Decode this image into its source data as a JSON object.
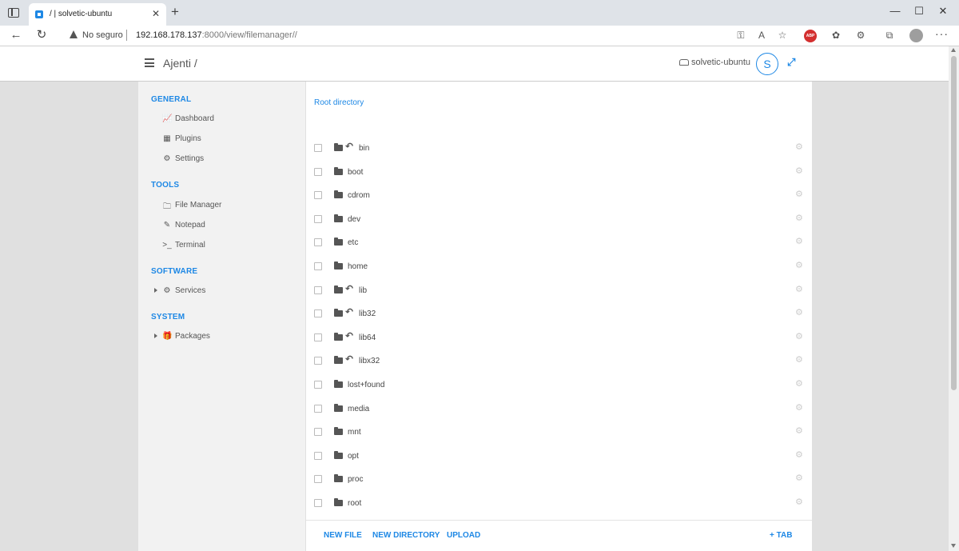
{
  "browser": {
    "tab_title": "/ | solvetic-ubuntu",
    "not_secure": "No seguro",
    "url_host": "192.168.178.137",
    "url_rest": ":8000/view/filemanager//",
    "abp": "ABP"
  },
  "header": {
    "brand": "Ajenti /",
    "hostname": "solvetic-ubuntu",
    "avatar_letter": "S"
  },
  "sidebar": {
    "general": "GENERAL",
    "dashboard": "Dashboard",
    "plugins": "Plugins",
    "settings": "Settings",
    "tools": "TOOLS",
    "file_manager": "File Manager",
    "notepad": "Notepad",
    "terminal": "Terminal",
    "software": "SOFTWARE",
    "services": "Services",
    "system": "SYSTEM",
    "packages": "Packages"
  },
  "main": {
    "breadcrumb": "Root directory",
    "files": [
      {
        "name": "bin",
        "symlink": true
      },
      {
        "name": "boot",
        "symlink": false
      },
      {
        "name": "cdrom",
        "symlink": false
      },
      {
        "name": "dev",
        "symlink": false
      },
      {
        "name": "etc",
        "symlink": false
      },
      {
        "name": "home",
        "symlink": false
      },
      {
        "name": "lib",
        "symlink": true
      },
      {
        "name": "lib32",
        "symlink": true
      },
      {
        "name": "lib64",
        "symlink": true
      },
      {
        "name": "libx32",
        "symlink": true
      },
      {
        "name": "lost+found",
        "symlink": false
      },
      {
        "name": "media",
        "symlink": false
      },
      {
        "name": "mnt",
        "symlink": false
      },
      {
        "name": "opt",
        "symlink": false
      },
      {
        "name": "proc",
        "symlink": false
      },
      {
        "name": "root",
        "symlink": false
      }
    ]
  },
  "footer": {
    "new_file": "NEW FILE",
    "new_directory": "NEW DIRECTORY",
    "upload": "UPLOAD",
    "add_tab": "+ TAB"
  },
  "colors": {
    "accent": "#1e88e5",
    "sidebar_bg": "#f2f2f2",
    "page_bg": "#e0e0e0"
  }
}
